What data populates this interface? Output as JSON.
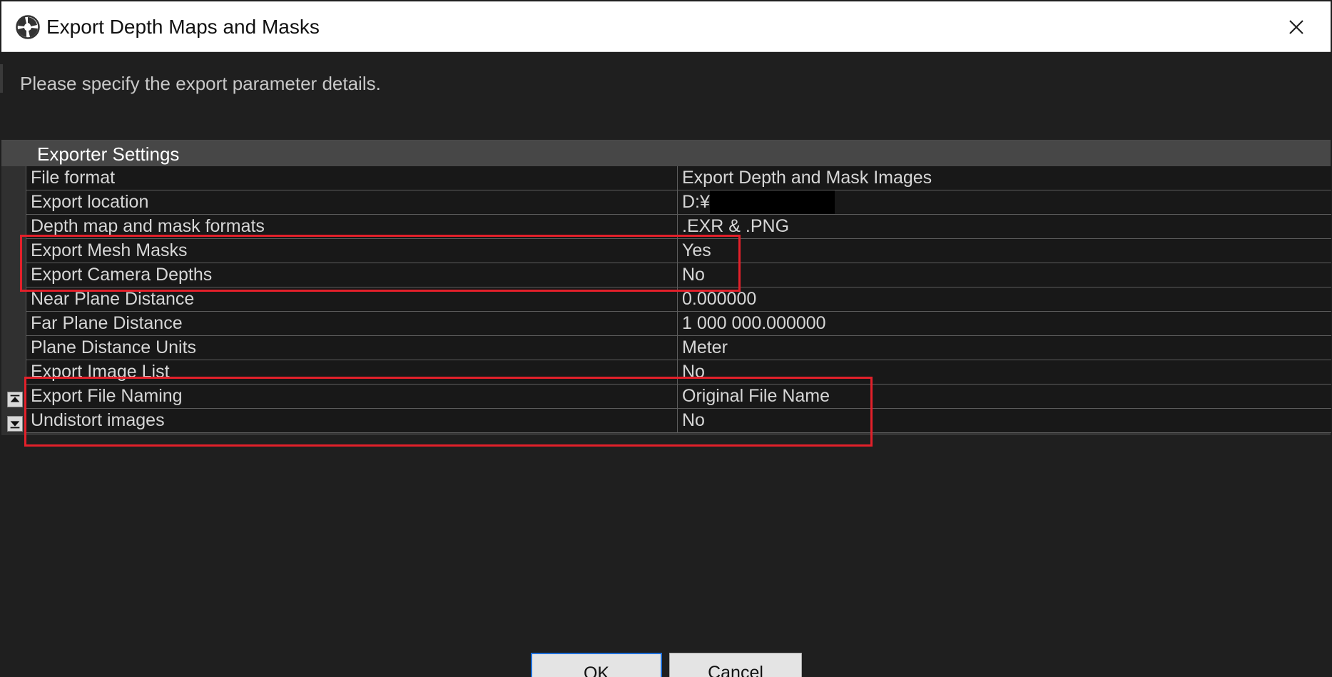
{
  "window": {
    "title": "Export Depth Maps and Masks",
    "icon": "app-logo-icon",
    "close_icon": "close-icon"
  },
  "instruction": "Please specify the export parameter details.",
  "settings": {
    "group_title": "Exporter Settings",
    "rows": [
      {
        "name": "File format",
        "value": "Export Depth and Mask Images"
      },
      {
        "name": "Export location",
        "value": "D:¥"
      },
      {
        "name": "Depth map and mask formats",
        "value": ".EXR & .PNG"
      },
      {
        "name": "Export Mesh Masks",
        "value": "Yes"
      },
      {
        "name": "Export Camera Depths",
        "value": "No"
      },
      {
        "name": "Near Plane Distance",
        "value": "0.000000"
      },
      {
        "name": "Far Plane Distance",
        "value": "1 000 000.000000"
      },
      {
        "name": "Plane Distance Units",
        "value": "Meter"
      },
      {
        "name": "Export Image List",
        "value": "No"
      },
      {
        "name": "Export File Naming",
        "value": "Original File Name"
      },
      {
        "name": "Undistort images",
        "value": "No"
      }
    ]
  },
  "scroll": {
    "up_icon": "scroll-up-icon",
    "down_icon": "scroll-down-icon"
  },
  "buttons": {
    "ok": "OK",
    "cancel": "Cancel"
  },
  "colors": {
    "background": "#1f1f1f",
    "highlight": "#e3202a",
    "ok_border": "#1e6fd9"
  }
}
